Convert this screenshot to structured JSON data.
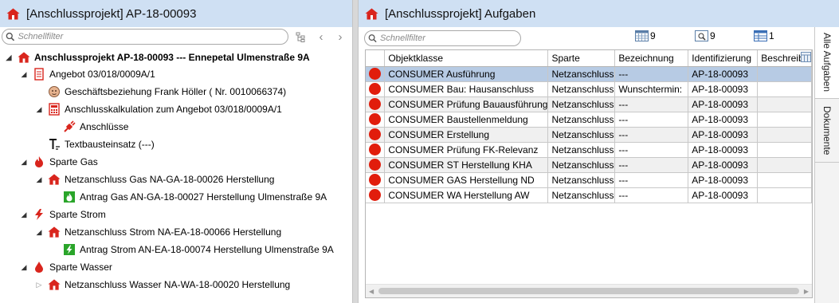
{
  "left": {
    "title": "[Anschlussprojekt] AP-18-00093",
    "filter_placeholder": "Schnellfilter",
    "tree": [
      {
        "label": "Anschlussprojekt AP-18-00093 --- Ennepetal Ulmenstraße 9A",
        "icon": "house-icon",
        "caret": "open",
        "bold": true
      },
      {
        "label": "Angebot 03/018/0009A/1",
        "icon": "document-icon",
        "caret": "open"
      },
      {
        "label": "Geschäftsbeziehung  Frank Höller ( Nr. 0010066374)",
        "icon": "person-icon",
        "caret": "none"
      },
      {
        "label": "Anschlusskalkulation zum Angebot 03/018/0009A/1",
        "icon": "calculator-icon",
        "caret": "open"
      },
      {
        "label": "Anschlüsse",
        "icon": "plug-icon",
        "caret": "none"
      },
      {
        "label": "Textbausteinsatz (---)",
        "icon": "text-icon",
        "caret": "none"
      },
      {
        "label": "Sparte Gas",
        "icon": "flame-icon",
        "caret": "open"
      },
      {
        "label": "Netzanschluss Gas NA-GA-18-00026 Herstellung",
        "icon": "house-icon",
        "caret": "open"
      },
      {
        "label": "Antrag Gas AN-GA-18-00027 Herstellung Ulmenstraße 9A",
        "icon": "green-flame-icon",
        "caret": "none"
      },
      {
        "label": "Sparte Strom",
        "icon": "lightning-icon",
        "caret": "open"
      },
      {
        "label": "Netzanschluss Strom NA-EA-18-00066 Herstellung",
        "icon": "house-icon",
        "caret": "open"
      },
      {
        "label": "Antrag Strom AN-EA-18-00074 Herstellung Ulmenstraße 9A",
        "icon": "green-bolt-icon",
        "caret": "none"
      },
      {
        "label": "Sparte Wasser",
        "icon": "drop-icon",
        "caret": "open"
      },
      {
        "label": "Netzanschluss Wasser NA-WA-18-00020 Herstellung",
        "icon": "house-icon",
        "caret": "closed"
      }
    ]
  },
  "right": {
    "title": "[Anschlussprojekt] Aufgaben",
    "filter_placeholder": "Schnellfilter",
    "counts": [
      "9",
      "9",
      "1"
    ],
    "columns": [
      "",
      "Objektklasse",
      "Sparte",
      "Bezeichnung",
      "Identifizierung",
      "Beschreib"
    ],
    "rows": [
      [
        "",
        "CONSUMER Ausführung",
        "Netzanschluss",
        "---",
        "AP-18-00093",
        ""
      ],
      [
        "",
        "CONSUMER Bau: Hausanschluss",
        "Netzanschluss",
        "Wunschtermin:",
        "AP-18-00093",
        ""
      ],
      [
        "",
        "CONSUMER Prüfung Bauausführung",
        "Netzanschluss",
        "---",
        "AP-18-00093",
        ""
      ],
      [
        "",
        "CONSUMER Baustellenmeldung",
        "Netzanschluss",
        "---",
        "AP-18-00093",
        ""
      ],
      [
        "",
        "CONSUMER Erstellung",
        "Netzanschluss",
        "---",
        "AP-18-00093",
        ""
      ],
      [
        "",
        "CONSUMER Prüfung FK-Relevanz",
        "Netzanschluss",
        "---",
        "AP-18-00093",
        ""
      ],
      [
        "",
        "CONSUMER ST Herstellung KHA",
        "Netzanschluss",
        "---",
        "AP-18-00093",
        ""
      ],
      [
        "",
        "CONSUMER GAS Herstellung ND",
        "Netzanschluss",
        "---",
        "AP-18-00093",
        ""
      ],
      [
        "",
        "CONSUMER WA Herstellung AW",
        "Netzanschluss",
        "---",
        "AP-18-00093",
        ""
      ]
    ],
    "side_tabs": [
      "Alle Aufgaben",
      "Dokumente"
    ]
  },
  "colors": {
    "titlebar": "#cfe0f3",
    "status_red": "#e11d0c",
    "selection": "#b7cbe4",
    "house_red": "#d9251d",
    "green": "#2aa52a"
  }
}
